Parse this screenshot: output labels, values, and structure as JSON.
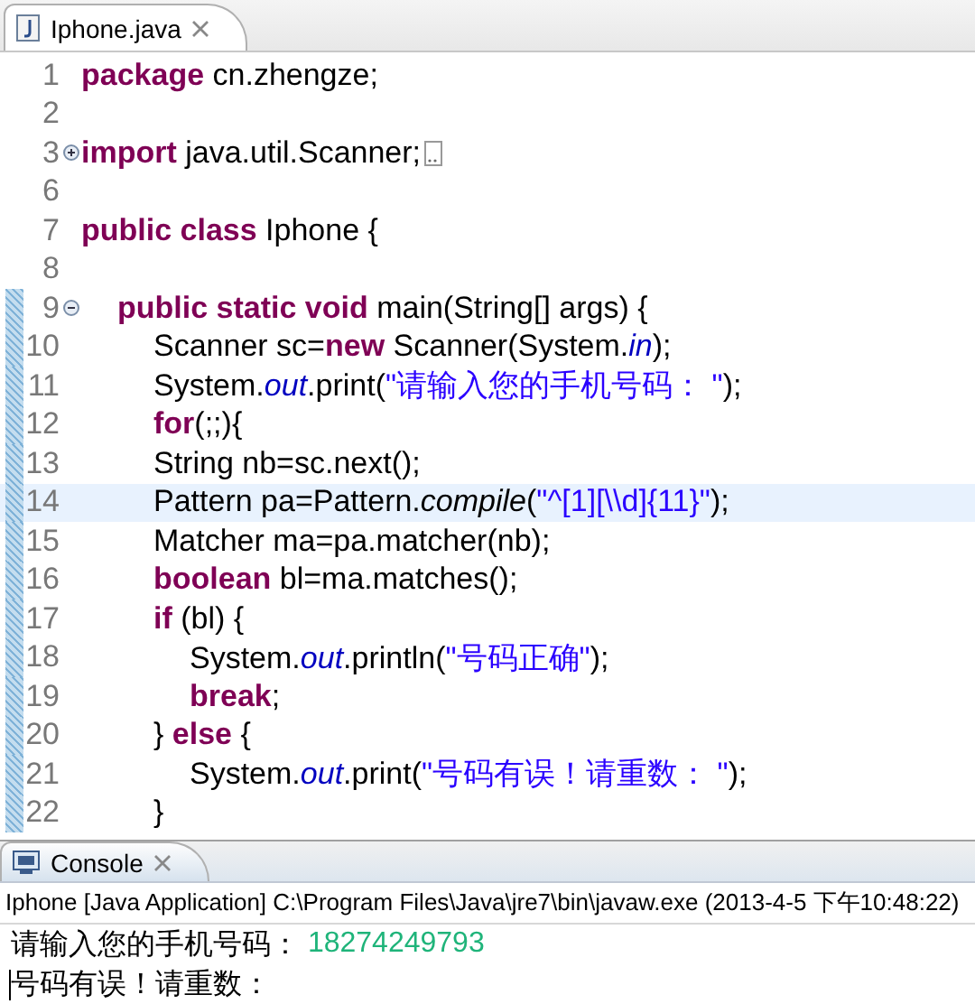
{
  "editor": {
    "tab": {
      "title": "Iphone.java",
      "selected": true
    },
    "lines": [
      {
        "number": "1",
        "current": false,
        "in_range": false,
        "kind": "plain",
        "tokens": [
          {
            "t": "package",
            "kind": "kw"
          },
          {
            "t": " cn.zhengze;",
            "kind": "plain"
          }
        ]
      },
      {
        "number": "2",
        "current": false,
        "in_range": false,
        "kind": "plain"
      },
      {
        "number": "3",
        "current": false,
        "in_range": false,
        "kind": "folded",
        "tokens": [
          {
            "t": "import",
            "kind": "kw"
          },
          {
            "t": " java.util.Scanner;",
            "kind": "plain"
          }
        ]
      },
      {
        "number": "6",
        "current": false,
        "in_range": false,
        "kind": "plain"
      },
      {
        "number": "7",
        "current": false,
        "in_range": false,
        "kind": "plain",
        "tokens": [
          {
            "t": "public class",
            "kind": "kw"
          },
          {
            "t": " Iphone {",
            "kind": "plain"
          }
        ],
        "children": [
          {
            "number": "8",
            "current": false,
            "in_range": false,
            "kind": "plain"
          },
          {
            "number": "9",
            "current": false,
            "in_range": true,
            "kind": "unfolded",
            "tokens": [
              {
                "t": "public static void",
                "kind": "kw"
              },
              {
                "t": " main(String[] args) {",
                "kind": "plain"
              }
            ],
            "children": [
              {
                "number": "10",
                "current": false,
                "in_range": true,
                "kind": "plain",
                "tokens": [
                  {
                    "t": "Scanner sc=",
                    "kind": "plain"
                  },
                  {
                    "t": "new",
                    "kind": "kw"
                  },
                  {
                    "t": " Scanner(System.",
                    "kind": "plain"
                  },
                  {
                    "t": "in",
                    "kind": "field"
                  },
                  {
                    "t": ");",
                    "kind": "plain"
                  }
                ]
              },
              {
                "number": "11",
                "current": false,
                "in_range": true,
                "kind": "plain",
                "tokens": [
                  {
                    "t": "System.",
                    "kind": "plain"
                  },
                  {
                    "t": "out",
                    "kind": "field"
                  },
                  {
                    "t": ".print(",
                    "kind": "plain"
                  },
                  {
                    "t": "\"请输入您的手机号码： \"",
                    "kind": "str"
                  },
                  {
                    "t": ");",
                    "kind": "plain"
                  }
                ]
              },
              {
                "number": "12",
                "current": false,
                "in_range": true,
                "kind": "plain",
                "tokens": [
                  {
                    "t": "for",
                    "kind": "kw"
                  },
                  {
                    "t": "(;;){",
                    "kind": "plain"
                  }
                ]
              },
              {
                "number": "13",
                "current": false,
                "in_range": true,
                "kind": "plain",
                "tokens": [
                  {
                    "t": "String nb=sc.next();",
                    "kind": "plain"
                  }
                ]
              },
              {
                "number": "14",
                "current": true,
                "in_range": true,
                "kind": "plain",
                "tokens": [
                  {
                    "t": "Pattern pa=Pattern.",
                    "kind": "plain"
                  },
                  {
                    "t": "compile",
                    "kind": "method"
                  },
                  {
                    "t": "(",
                    "kind": "plain"
                  },
                  {
                    "t": "\"^[1][\\\\d]{11}\"",
                    "kind": "str"
                  },
                  {
                    "t": ");",
                    "kind": "plain"
                  }
                ]
              },
              {
                "number": "15",
                "current": false,
                "in_range": true,
                "kind": "plain",
                "tokens": [
                  {
                    "t": "Matcher ma=pa.matcher(nb);",
                    "kind": "plain"
                  }
                ]
              },
              {
                "number": "16",
                "current": false,
                "in_range": true,
                "kind": "plain",
                "tokens": [
                  {
                    "t": "boolean",
                    "kind": "kw"
                  },
                  {
                    "t": " bl=ma.matches();",
                    "kind": "plain"
                  }
                ]
              },
              {
                "number": "17",
                "current": false,
                "in_range": true,
                "kind": "plain",
                "tokens": [
                  {
                    "t": "if",
                    "kind": "kw"
                  },
                  {
                    "t": " (bl) {",
                    "kind": "plain"
                  }
                ],
                "children": [
                  {
                    "number": "18",
                    "current": false,
                    "in_range": true,
                    "kind": "plain",
                    "tokens": [
                      {
                        "t": "System.",
                        "kind": "plain"
                      },
                      {
                        "t": "out",
                        "kind": "field"
                      },
                      {
                        "t": ".println(",
                        "kind": "plain"
                      },
                      {
                        "t": "\"号码正确\"",
                        "kind": "str"
                      },
                      {
                        "t": ");",
                        "kind": "plain"
                      }
                    ]
                  },
                  {
                    "number": "19",
                    "current": false,
                    "in_range": true,
                    "kind": "plain",
                    "tokens": [
                      {
                        "t": "break",
                        "kind": "kw"
                      },
                      {
                        "t": ";",
                        "kind": "plain"
                      }
                    ]
                  }
                ]
              },
              {
                "number": "20",
                "current": false,
                "in_range": true,
                "kind": "plain",
                "tokens": [
                  {
                    "t": "} ",
                    "kind": "plain"
                  },
                  {
                    "t": "else",
                    "kind": "kw"
                  },
                  {
                    "t": " {",
                    "kind": "plain"
                  }
                ],
                "children": [
                  {
                    "number": "21",
                    "current": false,
                    "in_range": true,
                    "kind": "plain",
                    "tokens": [
                      {
                        "t": "System.",
                        "kind": "plain"
                      },
                      {
                        "t": "out",
                        "kind": "field"
                      },
                      {
                        "t": ".print(",
                        "kind": "plain"
                      },
                      {
                        "t": "\"号码有误！请重数： \"",
                        "kind": "str"
                      },
                      {
                        "t": ");",
                        "kind": "plain"
                      }
                    ]
                  }
                ]
              },
              {
                "number": "22",
                "current": false,
                "in_range": true,
                "kind": "plain",
                "tokens": [
                  {
                    "t": "}",
                    "kind": "plain"
                  }
                ]
              }
            ]
          }
        ]
      }
    ]
  },
  "console": {
    "tab": {
      "title": "Console",
      "selected": true
    },
    "launch_info": "Iphone [Java Application] C:\\Program Files\\Java\\jre7\\bin\\javaw.exe (2013-4-5 下午10:48:22)",
    "output": [
      {
        "segments": [
          {
            "t": "请输入您的手机号码： ",
            "kind": "output"
          },
          {
            "t": "18274249793",
            "kind": "input"
          }
        ],
        "cursor": false
      },
      {
        "segments": [
          {
            "t": "号码有误！请重数：",
            "kind": "output"
          }
        ],
        "cursor": true
      }
    ]
  }
}
